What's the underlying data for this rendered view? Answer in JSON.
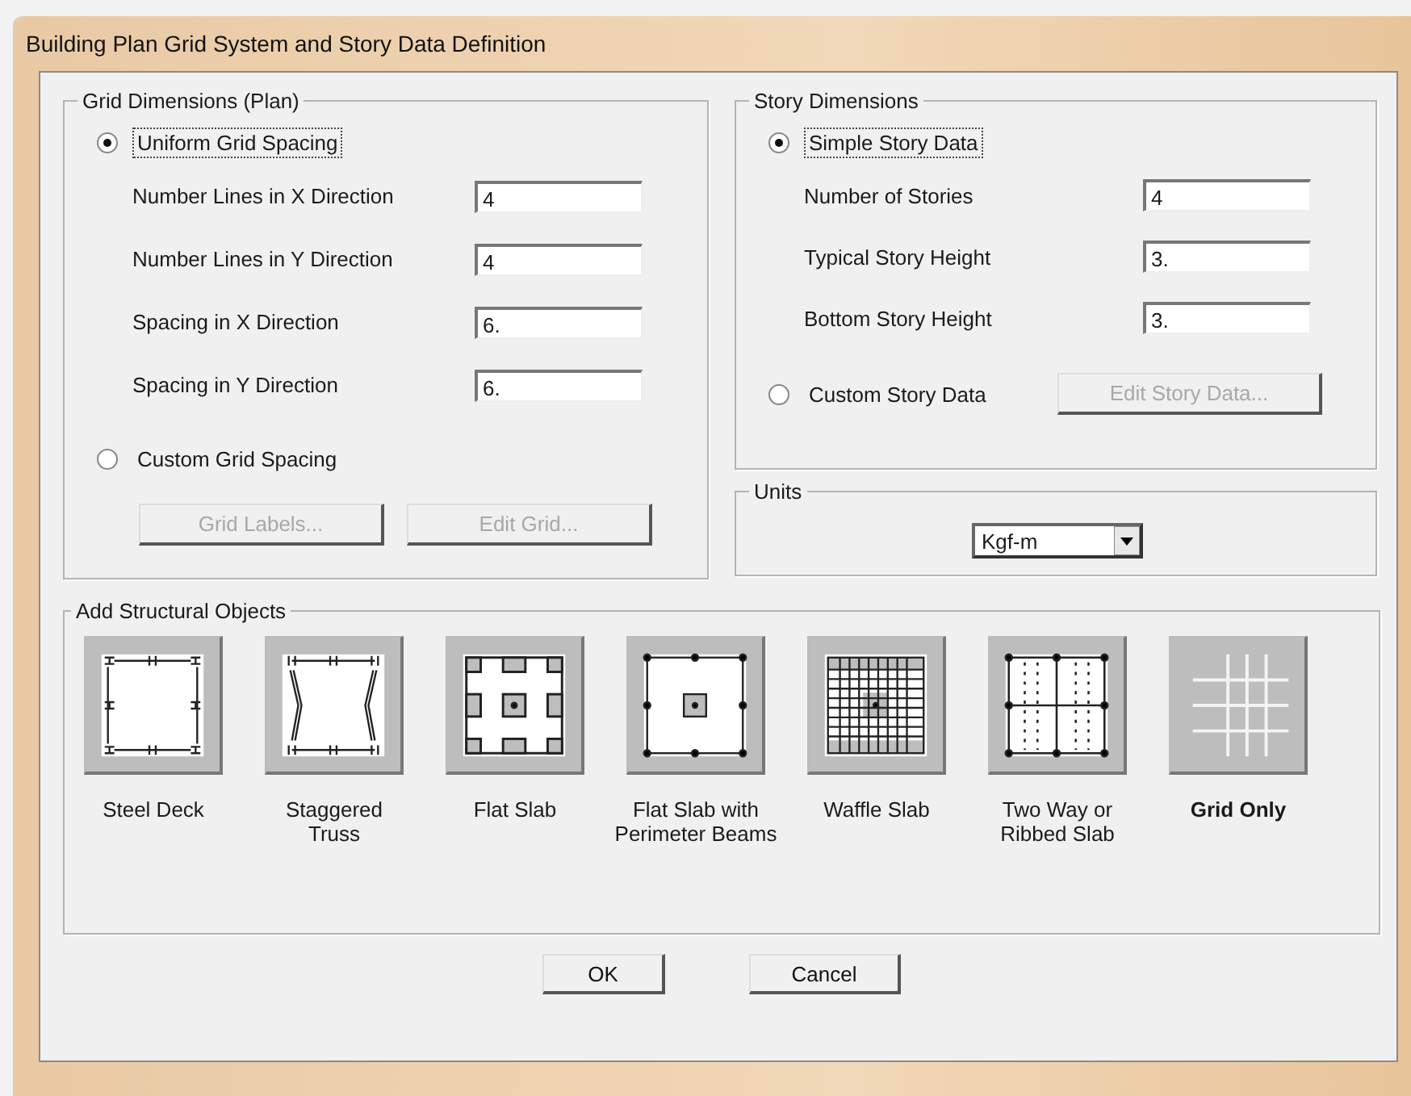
{
  "window": {
    "title": "Building Plan Grid System and Story Data Definition"
  },
  "grid_dimensions": {
    "title": "Grid Dimensions (Plan)",
    "options": [
      {
        "label": "Uniform Grid Spacing",
        "selected": true
      },
      {
        "label": "Custom Grid Spacing",
        "selected": false
      }
    ],
    "fields": [
      {
        "label": "Number Lines in X Direction",
        "value": "4"
      },
      {
        "label": "Number Lines in Y Direction",
        "value": "4"
      },
      {
        "label": "Spacing in X Direction",
        "value": "6."
      },
      {
        "label": "Spacing in Y Direction",
        "value": "6."
      }
    ],
    "buttons": [
      {
        "label": "Grid Labels...",
        "disabled": true
      },
      {
        "label": "Edit Grid...",
        "disabled": true
      }
    ]
  },
  "story_dimensions": {
    "title": "Story Dimensions",
    "options": [
      {
        "label": "Simple Story Data",
        "selected": true
      },
      {
        "label": "Custom Story Data",
        "selected": false
      }
    ],
    "fields": [
      {
        "label": "Number of Stories",
        "value": "4"
      },
      {
        "label": "Typical Story Height",
        "value": "3."
      },
      {
        "label": "Bottom Story Height",
        "value": "3."
      }
    ],
    "button": {
      "label": "Edit Story Data...",
      "disabled": true
    }
  },
  "units": {
    "title": "Units",
    "value": "Kgf-m"
  },
  "structural_objects": {
    "title": "Add Structural Objects",
    "items": [
      {
        "kind": "steel-deck",
        "label": "Steel Deck",
        "selected": false
      },
      {
        "kind": "staggered-truss",
        "label": "Staggered\nTruss",
        "selected": false
      },
      {
        "kind": "flat-slab",
        "label": "Flat Slab",
        "selected": false
      },
      {
        "kind": "flat-slab-perimeter",
        "label": "Flat Slab with\nPerimeter Beams",
        "selected": false
      },
      {
        "kind": "waffle-slab",
        "label": "Waffle Slab",
        "selected": false
      },
      {
        "kind": "two-way",
        "label": "Two Way or\nRibbed Slab",
        "selected": false
      },
      {
        "kind": "grid-only",
        "label": "Grid Only",
        "selected": true
      }
    ]
  },
  "buttons": [
    {
      "label": "OK"
    },
    {
      "label": "Cancel"
    }
  ]
}
